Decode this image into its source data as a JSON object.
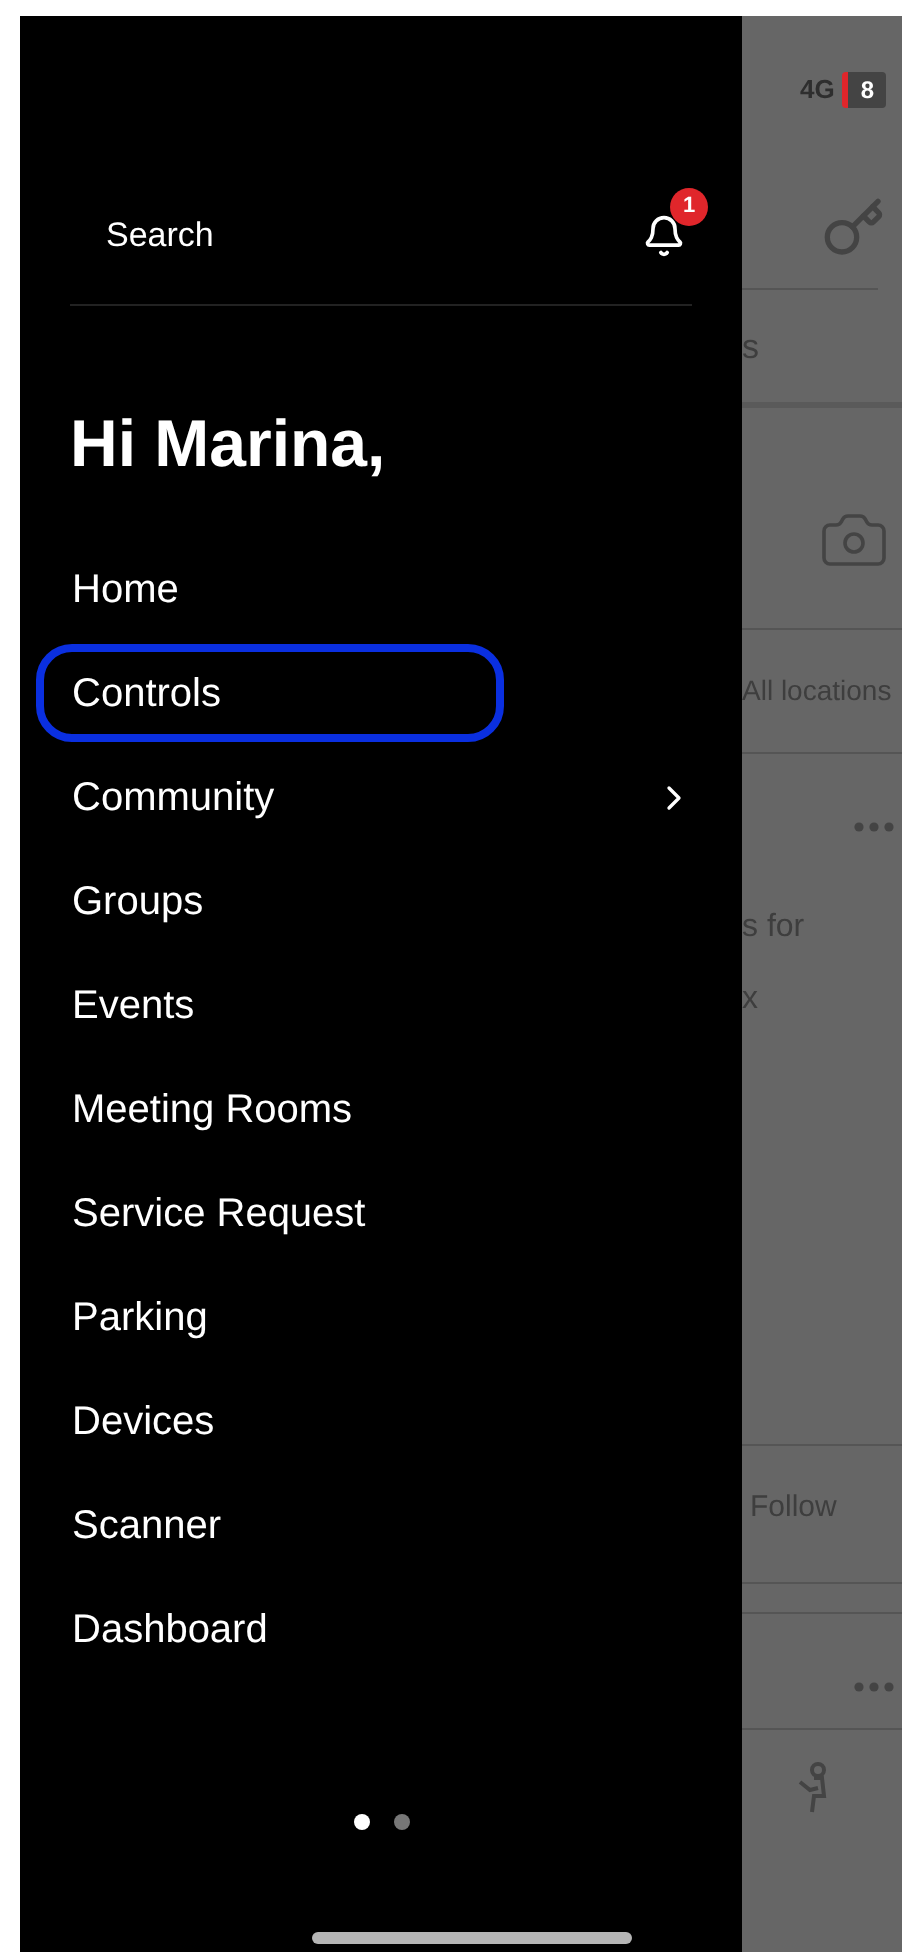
{
  "status_bar": {
    "network": "4G",
    "battery": "8"
  },
  "drawer": {
    "search_label": "Search",
    "notification_count": "1",
    "greeting": "Hi Marina,",
    "items": [
      {
        "label": "Home",
        "highlighted": false,
        "has_submenu": false
      },
      {
        "label": "Controls",
        "highlighted": true,
        "has_submenu": false
      },
      {
        "label": "Community",
        "highlighted": false,
        "has_submenu": true
      },
      {
        "label": "Groups",
        "highlighted": false,
        "has_submenu": false
      },
      {
        "label": "Events",
        "highlighted": false,
        "has_submenu": false
      },
      {
        "label": "Meeting Rooms",
        "highlighted": false,
        "has_submenu": false
      },
      {
        "label": "Service Request",
        "highlighted": false,
        "has_submenu": false
      },
      {
        "label": "Parking",
        "highlighted": false,
        "has_submenu": false
      },
      {
        "label": "Devices",
        "highlighted": false,
        "has_submenu": false
      },
      {
        "label": "Scanner",
        "highlighted": false,
        "has_submenu": false
      },
      {
        "label": "Dashboard",
        "highlighted": false,
        "has_submenu": false
      }
    ],
    "pages": [
      {
        "selected": true
      },
      {
        "selected": false
      }
    ]
  },
  "background": {
    "tab_fragment": "s",
    "filter_label": "All locations",
    "post_text_1": "s for",
    "post_text_2": "x",
    "follow_label": "Follow"
  }
}
